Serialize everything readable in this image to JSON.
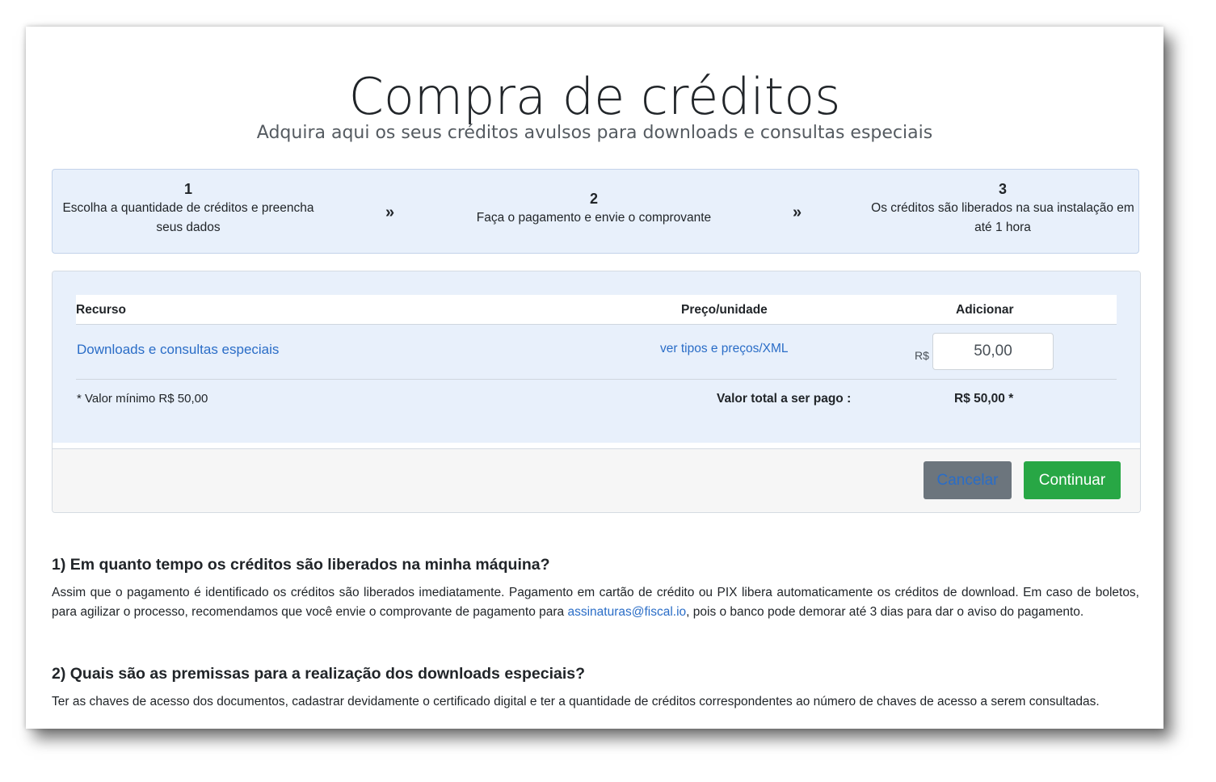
{
  "header": {
    "title": "Compra de créditos",
    "subtitle": "Adquira aqui os seus créditos avulsos para downloads e consultas especiais"
  },
  "steps": [
    {
      "number": "1",
      "text": "Escolha a quantidade de créditos e preencha seus dados"
    },
    {
      "number": "2",
      "text": "Faça o pagamento e envie o comprovante"
    },
    {
      "number": "3",
      "text": "Os créditos são liberados na sua instalação em até 1 hora"
    }
  ],
  "step_separator": "»",
  "table": {
    "headers": {
      "resource": "Recurso",
      "price": "Preço/unidade",
      "add": "Adicionar"
    },
    "row": {
      "resource": "Downloads e consultas especiais",
      "price_link": "ver tipos e preços/XML",
      "currency": "R$",
      "amount": "50,00"
    },
    "min_note": "* Valor mínimo R$ 50,00",
    "total_label": "Valor total a ser pago :",
    "total_value": "R$ 50,00 *"
  },
  "buttons": {
    "cancel": "Cancelar",
    "continue": "Continuar"
  },
  "faq": [
    {
      "question": "1) Em quanto tempo os créditos são liberados na minha máquina?",
      "answer_before": "Assim que o pagamento é identificado os créditos são liberados imediatamente. Pagamento em cartão de crédito ou PIX libera automaticamente os créditos de download. Em caso de boletos, para agilizar o processo, recomendamos que você envie o comprovante de pagamento para ",
      "email": "assinaturas@fiscal.io",
      "answer_after": ", pois o banco pode demorar até 3 dias para dar o aviso do pagamento."
    },
    {
      "question": "2) Quais são as premissas para a realização dos downloads especiais?",
      "answer": "Ter as chaves de acesso dos documentos, cadastrar devidamente o certificado digital e ter a quantidade de créditos correspondentes ao número de chaves de acesso a serem consultadas."
    }
  ],
  "colors": {
    "link": "#2a6dc7",
    "panel_bg": "#e8f0fb",
    "cancel_bg": "#6c757d",
    "continue_bg": "#28a745"
  }
}
